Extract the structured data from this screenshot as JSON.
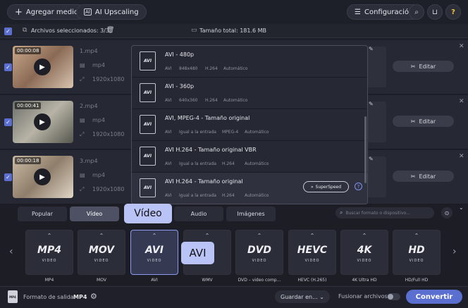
{
  "toolbar": {
    "add_media": "Agregar medio",
    "ai_upscaling": "AI Upscaling",
    "settings": "Configuración"
  },
  "selection": {
    "selected": "Archivos seleccionados: 3/3",
    "total": "Tamaño total: 181.6 MB"
  },
  "files": [
    {
      "time": "00:00:08",
      "name": "1.mp4",
      "format": "mp4",
      "res": "1920x1080",
      "edit": "Editar"
    },
    {
      "time": "00:00:41",
      "name": "2.mp4",
      "format": "mp4",
      "res": "1920x1080",
      "edit": "Editar"
    },
    {
      "time": "00:00:18",
      "name": "3.mp4",
      "format": "mp4",
      "res": "1920x1080",
      "edit": "Editar"
    }
  ],
  "formats": [
    {
      "name": "AVI - 480p",
      "a": "AVI",
      "b": "848x480",
      "c": "H.264",
      "d": "Automático"
    },
    {
      "name": "AVI - 360p",
      "a": "AVI",
      "b": "640x360",
      "c": "H.264",
      "d": "Automático"
    },
    {
      "name": "AVI, MPEG-4 - Tamaño original",
      "a": "AVI",
      "b": "Igual a la entrada",
      "c": "MPEG-4",
      "d": "Automático"
    },
    {
      "name": "AVI H.264 - Tamaño original VBR",
      "a": "AVI",
      "b": "Igual a la entrada",
      "c": "H.264",
      "d": "Automático"
    },
    {
      "name": "AVI H.264 - Tamaño original",
      "a": "AVI",
      "b": "Igual a la entrada",
      "c": "H.264",
      "d": "Automático"
    }
  ],
  "superspeed": "SuperSpeed",
  "format_icon_text": "AVI",
  "tabs": [
    "Popular",
    "Vídeo",
    "Audio",
    "Imágenes"
  ],
  "callouts": {
    "video": "Vídeo",
    "avi": "AVI"
  },
  "search_placeholder": "Buscar formato o dispositivo...",
  "cards": [
    {
      "logo": "MP4",
      "sub": "VIDEO",
      "label": "MP4"
    },
    {
      "logo": "MOV",
      "sub": "VIDEO",
      "label": "MOV"
    },
    {
      "logo": "AVI",
      "sub": "VIDEO",
      "label": "AVI"
    },
    {
      "logo": "",
      "sub": "",
      "label": "WMV"
    },
    {
      "logo": "DVD",
      "sub": "VIDEO",
      "label": "DVD – video comp..."
    },
    {
      "logo": "HEVC",
      "sub": "VIDEO",
      "label": "HEVC (H.265)"
    },
    {
      "logo": "4K",
      "sub": "VIDEO",
      "label": "4K Ultra HD"
    },
    {
      "logo": "HD",
      "sub": "VIDEO",
      "label": "HD/Full HD"
    }
  ],
  "footer": {
    "output_label": "Formato de salida:",
    "output_value": "MP4",
    "save_in": "Guardar en...",
    "merge": "Fusionar archivos:",
    "convert": "Convertir",
    "mp4_badge": "MP4"
  },
  "colors": {
    "accent": "#5a6fd0",
    "highlight": "#8a9bf0"
  }
}
